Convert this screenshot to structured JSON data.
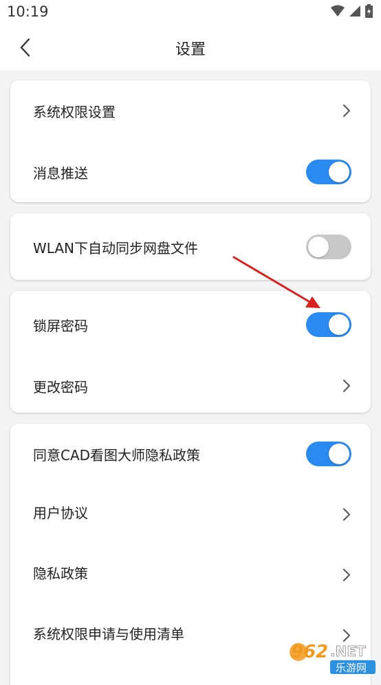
{
  "status": {
    "time": "10:19"
  },
  "header": {
    "title": "设置"
  },
  "group1": {
    "system_permissions": "系统权限设置",
    "push_notifications": "消息推送",
    "push_notifications_on": true
  },
  "group2": {
    "wlan_sync": "WLAN下自动同步网盘文件",
    "wlan_sync_on": false
  },
  "group3": {
    "lock_password": "锁屏密码",
    "lock_password_on": true,
    "change_password": "更改密码"
  },
  "group4": {
    "agree_privacy": "同意CAD看图大师隐私政策",
    "agree_privacy_on": true,
    "user_agreement": "用户协议",
    "privacy_policy": "隐私政策",
    "permission_list": "系统权限申请与使用清单"
  },
  "watermark": {
    "number": "962",
    "net": ".NET",
    "site": "乐游网"
  },
  "colors": {
    "accent": "#2b8af0",
    "toggle_off": "#c8c8c8",
    "annotation_arrow": "#d9211f"
  },
  "icons": [
    "back-arrow-icon",
    "wifi-icon",
    "signal-icon",
    "battery-icon",
    "chevron-right-icon"
  ]
}
